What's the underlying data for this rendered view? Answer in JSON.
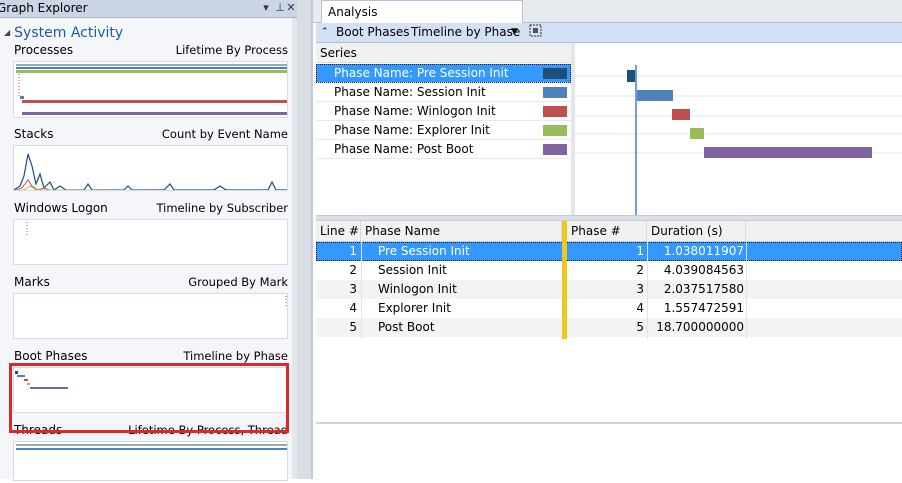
{
  "graph_explorer": {
    "title": "Graph Explorer",
    "group": "System Activity",
    "items": [
      {
        "name": "Processes",
        "view": "Lifetime By Process"
      },
      {
        "name": "Stacks",
        "view": "Count by Event Name"
      },
      {
        "name": "Windows Logon",
        "view": "Timeline by Subscriber"
      },
      {
        "name": "Marks",
        "view": "Grouped By Mark"
      },
      {
        "name": "Boot Phases",
        "view": "Timeline by Phase"
      },
      {
        "name": "Threads",
        "view": "Lifetime By Process, Thread"
      }
    ]
  },
  "analysis": {
    "tab": "Analysis",
    "toolbar": {
      "graph": "Boot Phases",
      "view": "Timeline by Phase"
    },
    "series_header": "Series",
    "series": [
      {
        "label": "Phase Name: Pre Session Init",
        "color": "#1f4e79",
        "selected": true
      },
      {
        "label": "Phase Name: Session Init",
        "color": "#4f81bd",
        "selected": false
      },
      {
        "label": "Phase Name: Winlogon Init",
        "color": "#c0504d",
        "selected": false
      },
      {
        "label": "Phase Name: Explorer Init",
        "color": "#9bbb59",
        "selected": false
      },
      {
        "label": "Phase Name: Post Boot",
        "color": "#8064a2",
        "selected": false
      }
    ],
    "table": {
      "columns": [
        "Line #",
        "Phase Name",
        "Phase #",
        "Duration (s)"
      ],
      "rows": [
        {
          "line": "1",
          "phase": "Pre Session Init",
          "num": "1",
          "duration": "1.038011907"
        },
        {
          "line": "2",
          "phase": "Session Init",
          "num": "2",
          "duration": "4.039084563"
        },
        {
          "line": "3",
          "phase": "Winlogon Init",
          "num": "3",
          "duration": "2.037517580"
        },
        {
          "line": "4",
          "phase": "Explorer Init",
          "num": "4",
          "duration": "1.557472591"
        },
        {
          "line": "5",
          "phase": "Post Boot",
          "num": "5",
          "duration": "18.700000000"
        }
      ]
    }
  },
  "colors": {
    "selection": "#3399ff",
    "accent": "#1e5aa8",
    "highlight_box": "#e0262a",
    "grouping_bar": "#f2c71d"
  }
}
